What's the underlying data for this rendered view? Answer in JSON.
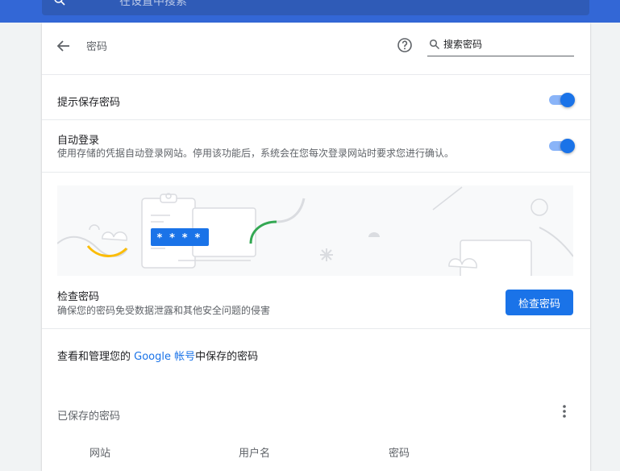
{
  "topbar": {
    "search_placeholder": "在设置中搜索",
    "bg_color": "#3367d6"
  },
  "header": {
    "back_icon": "arrow-back-icon",
    "title": "密码",
    "help_icon": "help-circle-icon",
    "search_icon": "search-icon",
    "search_placeholder": "搜索密码"
  },
  "settings": {
    "offer_save": {
      "label": "提示保存密码",
      "enabled": true
    },
    "auto_signin": {
      "label": "自动登录",
      "description": "使用存储的凭据自动登录网站。停用该功能后，系统会在您每次登录网站时要求您进行确认。",
      "enabled": true
    }
  },
  "illustration": {
    "masked_password": "* * * * |"
  },
  "check_passwords": {
    "title": "检查密码",
    "description": "确保您的密码免受数据泄露和其他安全问题的侵害",
    "button_label": "检查密码"
  },
  "manage": {
    "prefix": "查看和管理您的 ",
    "link": "Google 帐号",
    "suffix": "中保存的密码"
  },
  "saved_passwords": {
    "title": "已保存的密码",
    "more_icon": "more-vert-icon",
    "columns": [
      "网站",
      "用户名",
      "密码"
    ]
  },
  "colors": {
    "accent": "#1a73e8",
    "toggle_track": "#8ab4f8",
    "page_bg": "#f1f3f4"
  }
}
